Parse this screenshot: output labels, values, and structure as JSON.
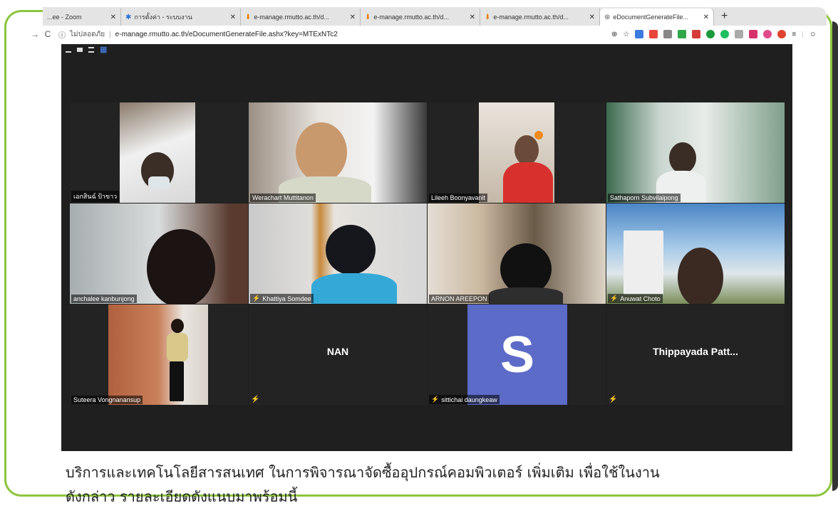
{
  "browser": {
    "tabs": [
      {
        "label": "...ee - Zoom",
        "icon": "zoom-icon",
        "active": false
      },
      {
        "label": "การตั้งค่า - ระบบงาน",
        "icon": "gear-icon",
        "active": false
      },
      {
        "label": "e-manage.rmutto.ac.th/d...",
        "icon": "download-icon",
        "active": false
      },
      {
        "label": "e-manage.rmutto.ac.th/d...",
        "icon": "download-icon",
        "active": false
      },
      {
        "label": "e-manage.rmutto.ac.th/d...",
        "icon": "download-icon",
        "active": false
      },
      {
        "label": "eDocumentGenerateFile...",
        "icon": "globe-icon",
        "active": true
      }
    ],
    "new_tab_label": "+",
    "insecure_label": "ไม่ปลอดภัย",
    "url": "e-manage.rmutto.ac.th/eDocumentGenerateFile.ashx?key=MTExNTc2"
  },
  "zoom": {
    "participants": [
      {
        "name": "เอกสินฉ์ ป้าขาว",
        "muted": false,
        "active": false
      },
      {
        "name": "Werachart Muttitanon",
        "muted": false,
        "active": false
      },
      {
        "name": "Lileeh Boonyavanit",
        "muted": false,
        "active": false
      },
      {
        "name": "Sathaporn Subvilaipong",
        "muted": false,
        "active": true
      },
      {
        "name": "anchalee kanbunjong",
        "muted": false,
        "active": false
      },
      {
        "name": "Khattiya Somdee",
        "muted": true,
        "active": false
      },
      {
        "name": "ARNON AREEPON",
        "muted": false,
        "active": false
      },
      {
        "name": "Anuwat Choto",
        "muted": true,
        "active": false
      },
      {
        "name": "Suteera Vongnanansup",
        "muted": false,
        "active": false
      },
      {
        "name": "NAN",
        "muted": true,
        "active": false
      },
      {
        "name": "sittichai daungkeaw",
        "muted": true,
        "active": false,
        "avatar_letter": "S"
      },
      {
        "name": "Thippayada Patt...",
        "muted": true,
        "active": false
      }
    ]
  },
  "document": {
    "line1": "บริการและเทคโนโลยีสารสนเทศ  ในการพิจารณาจัดซื้ออุปกรณ์คอมพิวเตอร์ เพิ่มเติม เพื่อใช้ในงาน",
    "line2": "ดังกล่าว  รายละเอียดดังแนบมาพร้อมนี้"
  },
  "colors": {
    "frame_green": "#8cc63f",
    "active_speaker": "#d4e34b",
    "avatar_bg": "#5c6bc8",
    "zoom_bg": "#1f1f1f"
  }
}
